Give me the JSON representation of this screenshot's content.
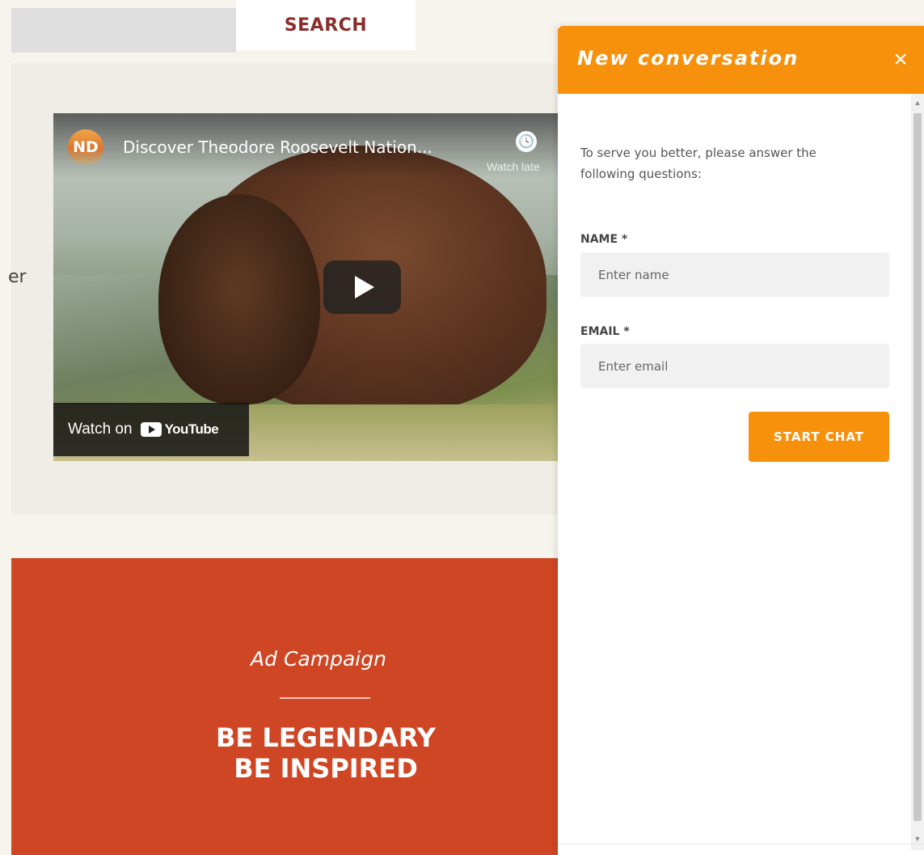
{
  "site": {
    "search_tab_label": "SEARCH",
    "left_cut_text": "er"
  },
  "video": {
    "channel_initials": "ND",
    "title": "Discover Theodore Roosevelt Nation...",
    "watch_later_label": "Watch late",
    "watch_on_label": "Watch on",
    "youtube_label": "YouTube"
  },
  "ad": {
    "subtitle": "Ad Campaign",
    "heading_line1": "BE LEGENDARY",
    "heading_line2": "BE INSPIRED"
  },
  "chat": {
    "title": "New conversation",
    "intro_text": "To serve you better, please answer the following questions:",
    "name_label": "NAME *",
    "name_placeholder": "Enter name",
    "email_label": "EMAIL *",
    "email_placeholder": "Enter email",
    "start_button_label": "START CHAT"
  },
  "colors": {
    "accent_orange": "#f7910c",
    "ad_red": "#cf4624",
    "search_text": "#8a2d2d"
  },
  "icons": [
    "close-icon",
    "clock-icon",
    "play-icon",
    "youtube-icon"
  ]
}
